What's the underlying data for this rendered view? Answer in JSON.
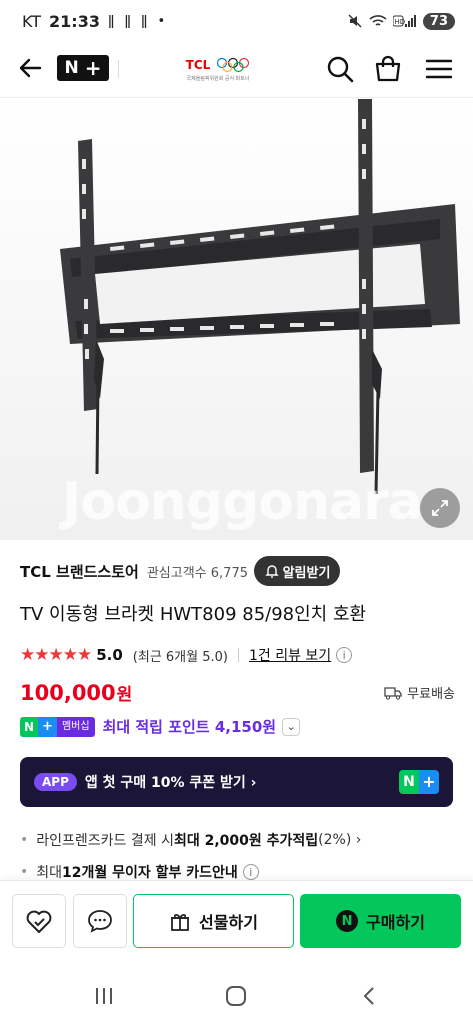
{
  "status": {
    "carrier": "KT",
    "time": "21:33",
    "notifications": "ǁ ǁ ǁ •",
    "battery": "73"
  },
  "header": {
    "nplus_label": "N",
    "nplus_plus": "+",
    "brand_logo_text": "TCL",
    "brand_logo_sub": "국제올림픽위원회 공식 파트너"
  },
  "image": {
    "watermark": "Joonggonara"
  },
  "store": {
    "name": "TCL 브랜드스토어",
    "followers_label": "관심고객수",
    "followers_count": "6,775",
    "alarm_button": "알림받기"
  },
  "product": {
    "title": "TV 이동형 브라켓 HWT809 85/98인치 호환",
    "stars": "★★★★★",
    "rating": "5.0",
    "recent_rating": "(최근 6개월 5.0)",
    "review_link": "1건 리뷰 보기",
    "info_icon": "i",
    "price": "100,000",
    "currency": "원",
    "shipping": "무료배송"
  },
  "membership": {
    "badge_n": "N",
    "badge_plus": "+",
    "badge_text": "멤버십",
    "points": "최대 적립 포인트 4,150원",
    "chevron": "⌄"
  },
  "app_banner": {
    "pill": "APP",
    "text": "앱 첫 구매 10% 쿠폰 받기 ›",
    "logo_n": "N",
    "logo_plus": "+"
  },
  "benefits": {
    "line1_pre": "라인프렌즈카드 결제 시 ",
    "line1_bold": "최대 2,000원 추가적립",
    "line1_post": " (2%) ›",
    "line2_pre": "최대 ",
    "line2_bold": "12개월 무이자 할부 카드안내",
    "line2_icon": "i"
  },
  "bottom": {
    "gift_label": "선물하기",
    "buy_label": "구매하기",
    "buy_icon": "N"
  },
  "colors": {
    "price_red": "#e8001c",
    "naver_green": "#03c75a",
    "point_purple": "#6a2ee0",
    "banner_dark": "#1b1538"
  }
}
